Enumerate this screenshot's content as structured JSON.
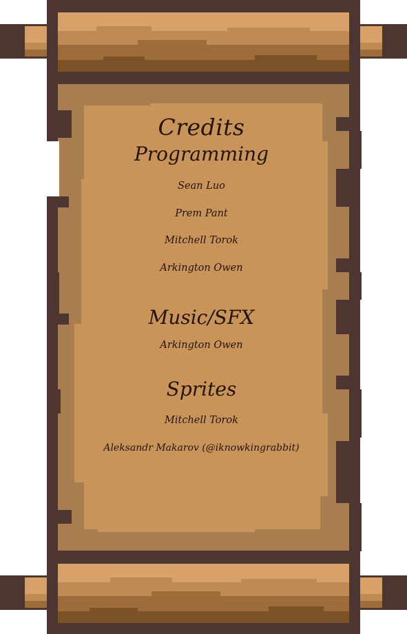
{
  "title": "Credits",
  "sections": [
    {
      "heading": "Programming",
      "names": [
        "Sean Luo",
        "Prem Pant",
        "Mitchell Torok",
        "Arkington Owen"
      ]
    },
    {
      "heading": "Music/SFX",
      "names": [
        "Arkington Owen"
      ]
    },
    {
      "heading": "Sprites",
      "names": [
        "Mitchell Torok",
        "Aleksandr Makarov (@iknowkingrabbit)"
      ]
    }
  ],
  "colors": {
    "outline": "#4d3532",
    "rod_light": "#d7a169",
    "rod_mid": "#bf8a54",
    "rod_dark": "#9c6c39",
    "rod_darkest": "#7b5226",
    "paper_edge": "#a87d4f",
    "paper_center": "#c89459",
    "ink": "#24140c"
  },
  "icons": [
    "scroll-top-rod",
    "scroll-bottom-rod"
  ]
}
